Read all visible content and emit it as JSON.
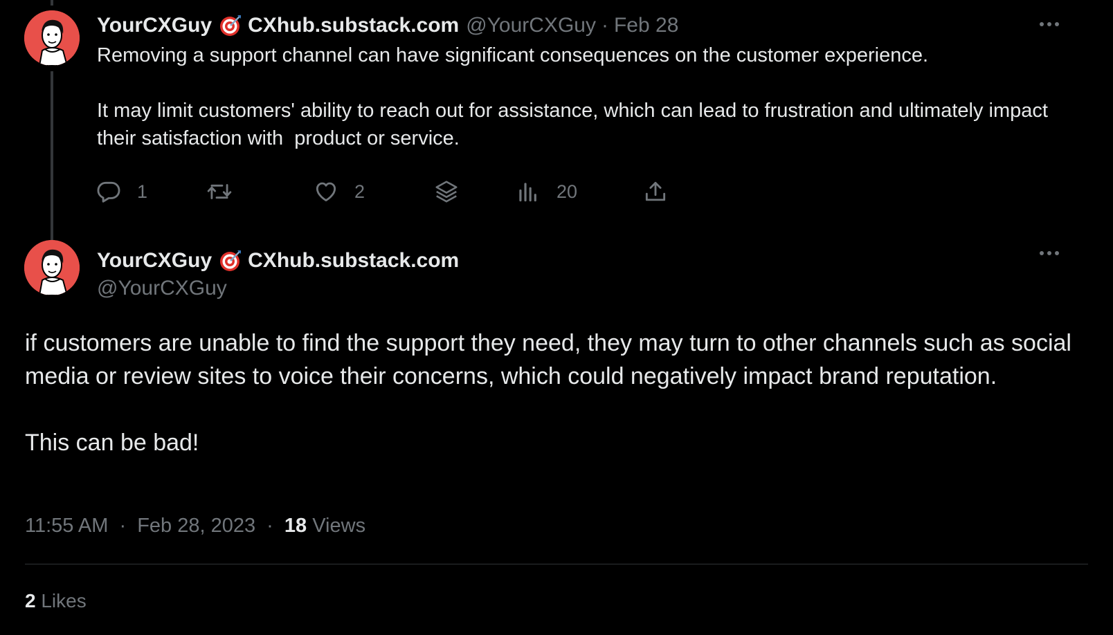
{
  "tweet1": {
    "author_name": "YourCXGuy",
    "author_site": "CXhub.substack.com",
    "handle": "@YourCXGuy",
    "separator": "·",
    "date": "Feb 28",
    "paragraphs": [
      "Removing a support channel can have significant consequences on the customer experience.",
      "It may limit customers' ability to reach out for assistance, which can lead to frustration and ultimately impact their satisfaction with  product or service."
    ],
    "actions": {
      "reply_count": "1",
      "retweet_count": "",
      "like_count": "2",
      "views_count": "20"
    }
  },
  "tweet2": {
    "author_name": "YourCXGuy",
    "author_site": "CXhub.substack.com",
    "handle": "@YourCXGuy",
    "paragraphs": [
      "if customers are unable to find the support they need, they may turn to other channels such as social media or review sites to voice their concerns, which could negatively impact brand reputation.",
      "This can be bad!"
    ],
    "time": "11:55 AM",
    "separator": "·",
    "full_date": "Feb 28, 2023",
    "views_count": "18",
    "views_label": "Views",
    "likes_count": "2",
    "likes_label": "Likes"
  },
  "icons": {
    "target": "direct-hit-emoji",
    "more": "more-horizontal-icon",
    "reply": "reply-icon",
    "retweet": "retweet-icon",
    "like": "heart-icon",
    "stack": "layers-icon",
    "analytics": "analytics-icon",
    "share": "share-icon"
  },
  "colors": {
    "background": "#000000",
    "text_primary": "#e7e9ea",
    "text_secondary": "#71767b",
    "divider": "#2f3336",
    "avatar_bg": "#e8504a"
  }
}
